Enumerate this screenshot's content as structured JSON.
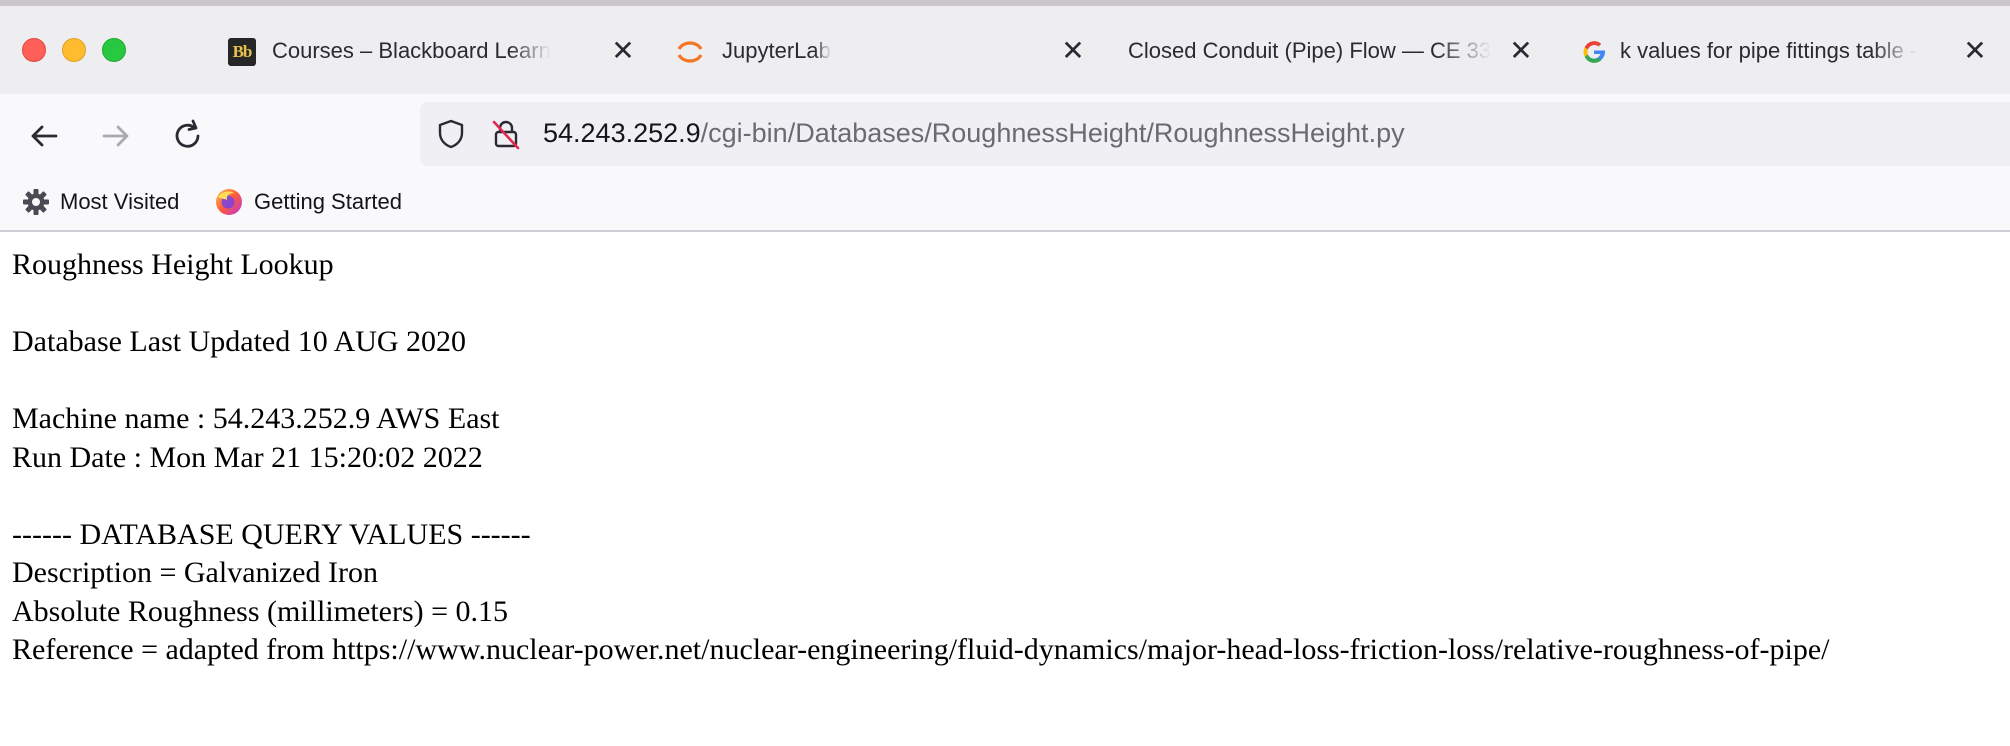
{
  "browser": {
    "tabs": [
      {
        "icon": "blackboard-icon",
        "favicon_text": "Bb",
        "label": "Courses – Blackboard Learn"
      },
      {
        "icon": "jupyter-icon",
        "label": "JupyterLab"
      },
      {
        "icon": "none",
        "label": "Closed Conduit (Pipe) Flow — CE 33"
      },
      {
        "icon": "google-icon",
        "label": "k values for pipe fittings table - "
      }
    ],
    "close_glyph": "✕",
    "url": {
      "host": "54.243.252.9",
      "path": "/cgi-bin/Databases/RoughnessHeight/RoughnessHeight.py"
    },
    "bookmarks": [
      {
        "icon": "gear-icon",
        "label": "Most Visited"
      },
      {
        "icon": "firefox-icon",
        "label": "Getting Started"
      }
    ]
  },
  "page": {
    "title": "Roughness Height Lookup",
    "updated": "Database Last Updated 10 AUG 2020",
    "machine": "Machine name : 54.243.252.9 AWS East",
    "run_date": "Run Date : Mon Mar 21 15:20:02 2022",
    "section_header": "------ DATABASE QUERY VALUES ------",
    "description": "Description = Galvanized Iron",
    "roughness": "Absolute Roughness (millimeters) = 0.15",
    "reference": "Reference = adapted from https://www.nuclear-power.net/nuclear-engineering/fluid-dynamics/major-head-loss-friction-loss/relative-roughness-of-pipe/"
  },
  "colors": {
    "tabstrip": "#eeedf0",
    "toolbar": "#f9f9fb",
    "urlbar": "#f0f0f4",
    "jupyter_orange": "#f37726"
  }
}
